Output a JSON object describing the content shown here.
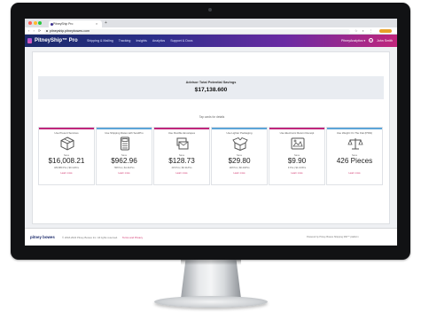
{
  "browser": {
    "tab_title": "PitneyShip Pro",
    "tab_close": "×",
    "new_tab": "+",
    "nav_buttons": "‹ › ⟳",
    "url": "pitneyship.pitneybowes.com",
    "ext_icons": "☆ ◐ ⋮"
  },
  "app_nav": {
    "brand": "PitneyShip™ Pro",
    "links": [
      "Shipping & Mailing",
      "Tracking",
      "Insights",
      "Analytics",
      "Support & Docs"
    ],
    "account_menu": "PitneyAnalytics ▾",
    "help": "?",
    "user_name": "John Smith"
  },
  "summary": {
    "title": "Advisor Total Potential Savings",
    "total": "$17,138.600"
  },
  "tip": "Tap cards for details",
  "cards": [
    {
      "title": "Use Presort Services",
      "icon": "box-package-icon",
      "accent": "#c0267c",
      "save_label": "Save",
      "value": "$16,008.21",
      "subtext": "480,889 Pcs   |   $0.11/Pcs",
      "link": "Learn more"
    },
    {
      "title": "Use Shipping Rates with SendPro",
      "icon": "calculator-icon",
      "accent": "#5ca5d8",
      "save_label": "Save",
      "value": "$962.96",
      "subtext": "798 Pcs   |   $1.21/Pcs",
      "link": "Learn more"
    },
    {
      "title": "Use Flexible Envelopes",
      "icon": "envelope-stack-icon",
      "accent": "#c0267c",
      "save_label": "Save",
      "value": "$128.73",
      "subtext": "415 Pcs   |   $0.31/Pcs",
      "link": "Learn more"
    },
    {
      "title": "Use Lighter Packaging",
      "icon": "open-box-icon",
      "accent": "#5ca5d8",
      "save_label": "Save",
      "value": "$29.80",
      "subtext": "148 Pcs   |   $0.20/Pcs",
      "link": "Learn more"
    },
    {
      "title": "Use Electronic Return Receipt",
      "icon": "receipt-icon",
      "accent": "#c0267c",
      "save_label": "Save",
      "value": "$9.90",
      "subtext": "9 Pcs   |   $1.10/Pcs",
      "link": "Learn more"
    },
    {
      "title": "Use Weight On The Flat (PSW)",
      "icon": "scale-icon",
      "accent": "#5ca5d8",
      "save_label": "Save",
      "value": "426 Pieces",
      "subtext": "",
      "link": "Learn more"
    }
  ],
  "footer": {
    "brand": "pitney bowes",
    "copyright": "© 2018-2022 Pitney Bowes Inc. All rights reserved.",
    "terms": "Terms and Privacy",
    "right": "Powered by Pitney Bowes Shipping 360™ platform"
  },
  "colors": {
    "nav_start": "#1b2a6b",
    "nav_end": "#c0267c",
    "accent_magenta": "#c0267c",
    "accent_blue": "#5ca5d8"
  }
}
